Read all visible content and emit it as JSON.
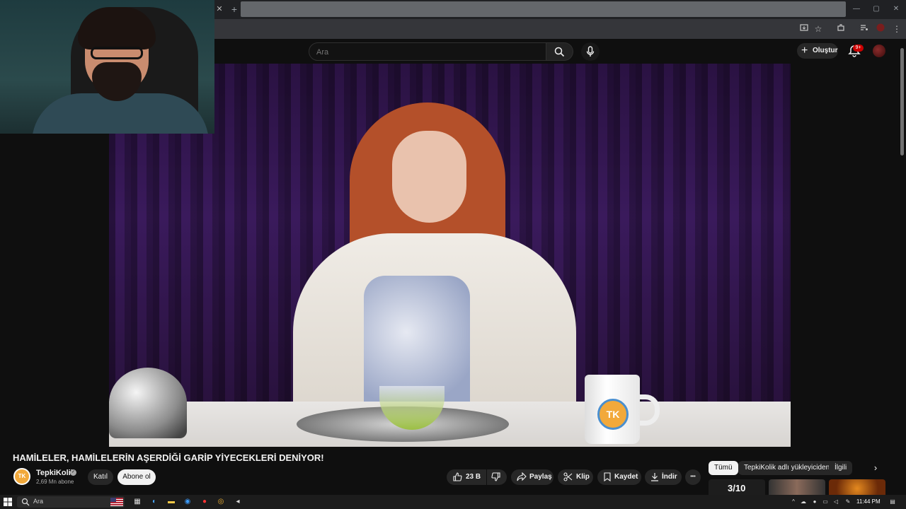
{
  "browser": {
    "tab_close": "✕",
    "new_tab": "+",
    "window_controls": [
      "—",
      "▢",
      "✕"
    ],
    "toolbar_icons": [
      "install-icon",
      "star-icon",
      "extensions-icon",
      "media-icon",
      "profile-icon",
      "menu-icon"
    ]
  },
  "masthead": {
    "search_placeholder": "Ara",
    "create_label": "Oluştur",
    "notification_badge": "9+"
  },
  "video": {
    "title": "HAMİLELER, HAMİLELERİN AŞERDİĞİ GARİP YİYECEKLERİ DENİYOR!",
    "mug_logo": "TK"
  },
  "channel": {
    "avatar_text": "TK",
    "name": "TepkiKolik",
    "verified_mark": "✓",
    "subscribers": "2,69 Mn abone",
    "join_label": "Katıl",
    "subscribe_label": "Abone ol"
  },
  "actions": {
    "likes": "23 B",
    "share": "Paylaş",
    "clip": "Klip",
    "save": "Kaydet",
    "download": "İndir",
    "more": "•••"
  },
  "chips": {
    "all": "Tümü",
    "uploader": "TepkiKolik adlı yükleyiciden",
    "related": "İlgili",
    "next": "›"
  },
  "playlist": {
    "counter": "3/10"
  },
  "taskbar": {
    "search_placeholder": "Ara",
    "clock": "11:44 PM"
  }
}
